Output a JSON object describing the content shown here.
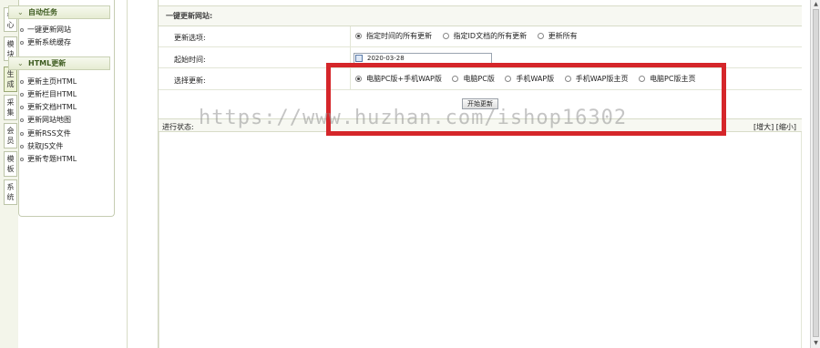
{
  "vertical_tabs": [
    "核心",
    "模块",
    "生成",
    "采集",
    "会员",
    "模板",
    "系统"
  ],
  "menu": {
    "groups": [
      {
        "title": "自动任务",
        "items": [
          "一键更新网站",
          "更新系统缓存"
        ]
      },
      {
        "title": "HTML更新",
        "items": [
          "更新主页HTML",
          "更新栏目HTML",
          "更新文档HTML",
          "更新网站地图",
          "更新RSS文件",
          "获取JS文件",
          "更新专题HTML"
        ]
      }
    ]
  },
  "form": {
    "title": "一键更新网站:",
    "update_option": {
      "label": "更新选项:",
      "options": [
        "指定时间的所有更新",
        "指定ID文档的所有更新",
        "更新所有"
      ],
      "selected": 0
    },
    "start_time": {
      "label": "起始时间:",
      "value": "2020-03-28"
    },
    "select_update": {
      "label": "选择更新:",
      "options": [
        "电脑PC版+手机WAP版",
        "电脑PC版",
        "手机WAP版",
        "手机WAP版主页",
        "电脑PC版主页"
      ],
      "selected": 0
    },
    "start_button": "开始更新"
  },
  "status": {
    "label": "进行状态:",
    "zoom_in": "[增大]",
    "zoom_out": "[缩小]"
  },
  "watermark": "https://www.huzhan.com/ishop16302",
  "colors": {
    "highlight": "#d5262a",
    "menu_header_text": "#3d5b1f"
  }
}
